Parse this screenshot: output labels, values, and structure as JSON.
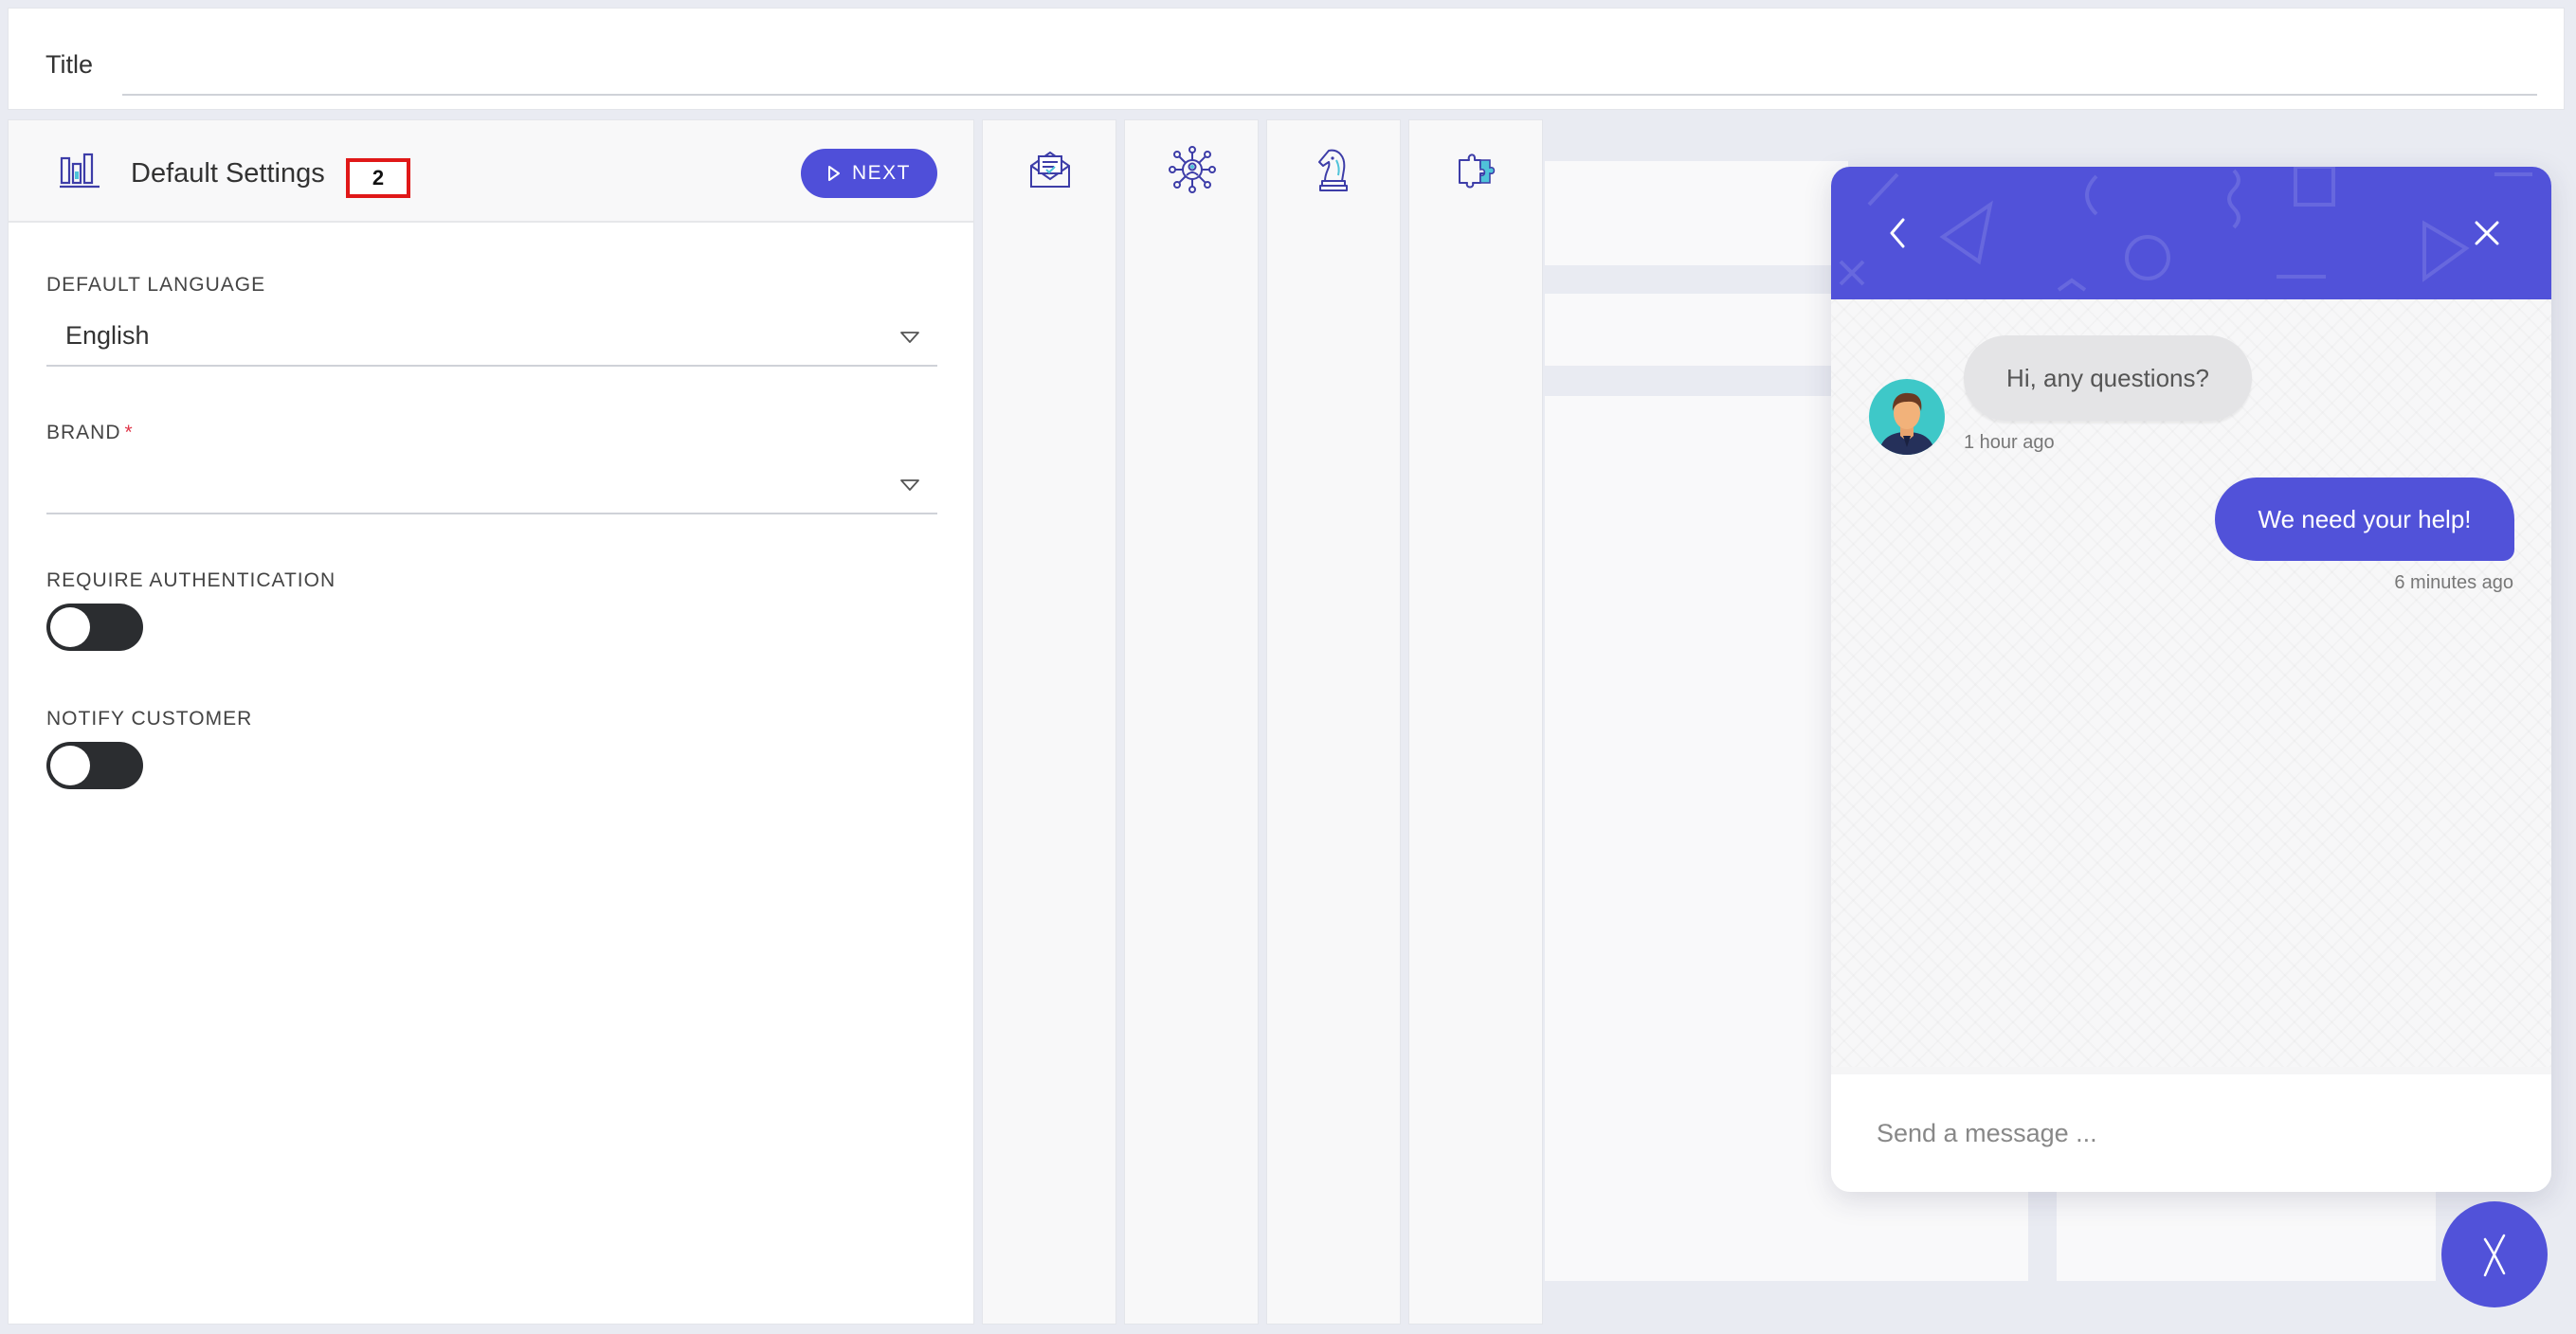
{
  "title_bar": {
    "label": "Title",
    "value": ""
  },
  "settings": {
    "header_title": "Default Settings",
    "badge": "2",
    "next_label": "NEXT",
    "fields": {
      "default_language": {
        "label": "DEFAULT LANGUAGE",
        "value": "English"
      },
      "brand": {
        "label": "BRAND",
        "required_mark": "*",
        "value": ""
      },
      "require_auth": {
        "label": "REQUIRE AUTHENTICATION",
        "on": false
      },
      "notify_customer": {
        "label": "NOTIFY CUSTOMER",
        "on": false
      }
    }
  },
  "steps": [
    {
      "icon": "email-document-icon"
    },
    {
      "icon": "user-network-icon"
    },
    {
      "icon": "chess-knight-icon"
    },
    {
      "icon": "puzzle-piece-icon"
    }
  ],
  "chat": {
    "messages": [
      {
        "from": "agent",
        "text": "Hi, any questions?",
        "time": "1 hour ago"
      },
      {
        "from": "user",
        "text": "We need your help!",
        "time": "6 minutes ago"
      }
    ],
    "input_placeholder": "Send a message ..."
  },
  "colors": {
    "accent": "#5152d9",
    "toggle_off": "#2b2d30",
    "badge_border": "#e01818",
    "required": "#e0374a"
  }
}
